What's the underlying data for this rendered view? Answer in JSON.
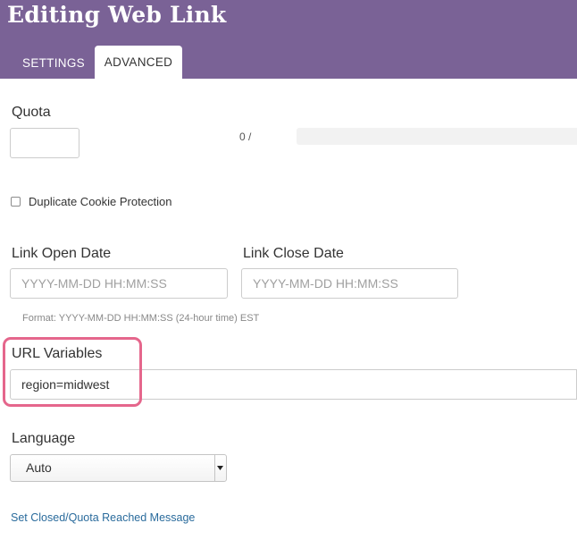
{
  "header": {
    "title": "Editing Web Link",
    "tabs": [
      {
        "label": "SETTINGS",
        "active": false
      },
      {
        "label": "ADVANCED",
        "active": true
      }
    ],
    "background_color": "#7a6296"
  },
  "quota": {
    "label": "Quota",
    "value": "",
    "count_text": "0 /",
    "progress_fraction": 0
  },
  "duplicate_cookie": {
    "label": "Duplicate Cookie Protection",
    "checked": false
  },
  "dates": {
    "open_label": "Link Open Date",
    "open_placeholder": "YYYY-MM-DD HH:MM:SS",
    "close_label": "Link Close Date",
    "close_placeholder": "YYYY-MM-DD HH:MM:SS",
    "format_hint": "Format: YYYY-MM-DD HH:MM:SS (24-hour time) EST"
  },
  "url_variables": {
    "label": "URL Variables",
    "value": "region=midwest",
    "highlight_color": "#e5668c"
  },
  "language": {
    "label": "Language",
    "selected": "Auto"
  },
  "closed_message_link": {
    "label": "Set Closed/Quota Reached Message",
    "color": "#2a6b9c"
  }
}
